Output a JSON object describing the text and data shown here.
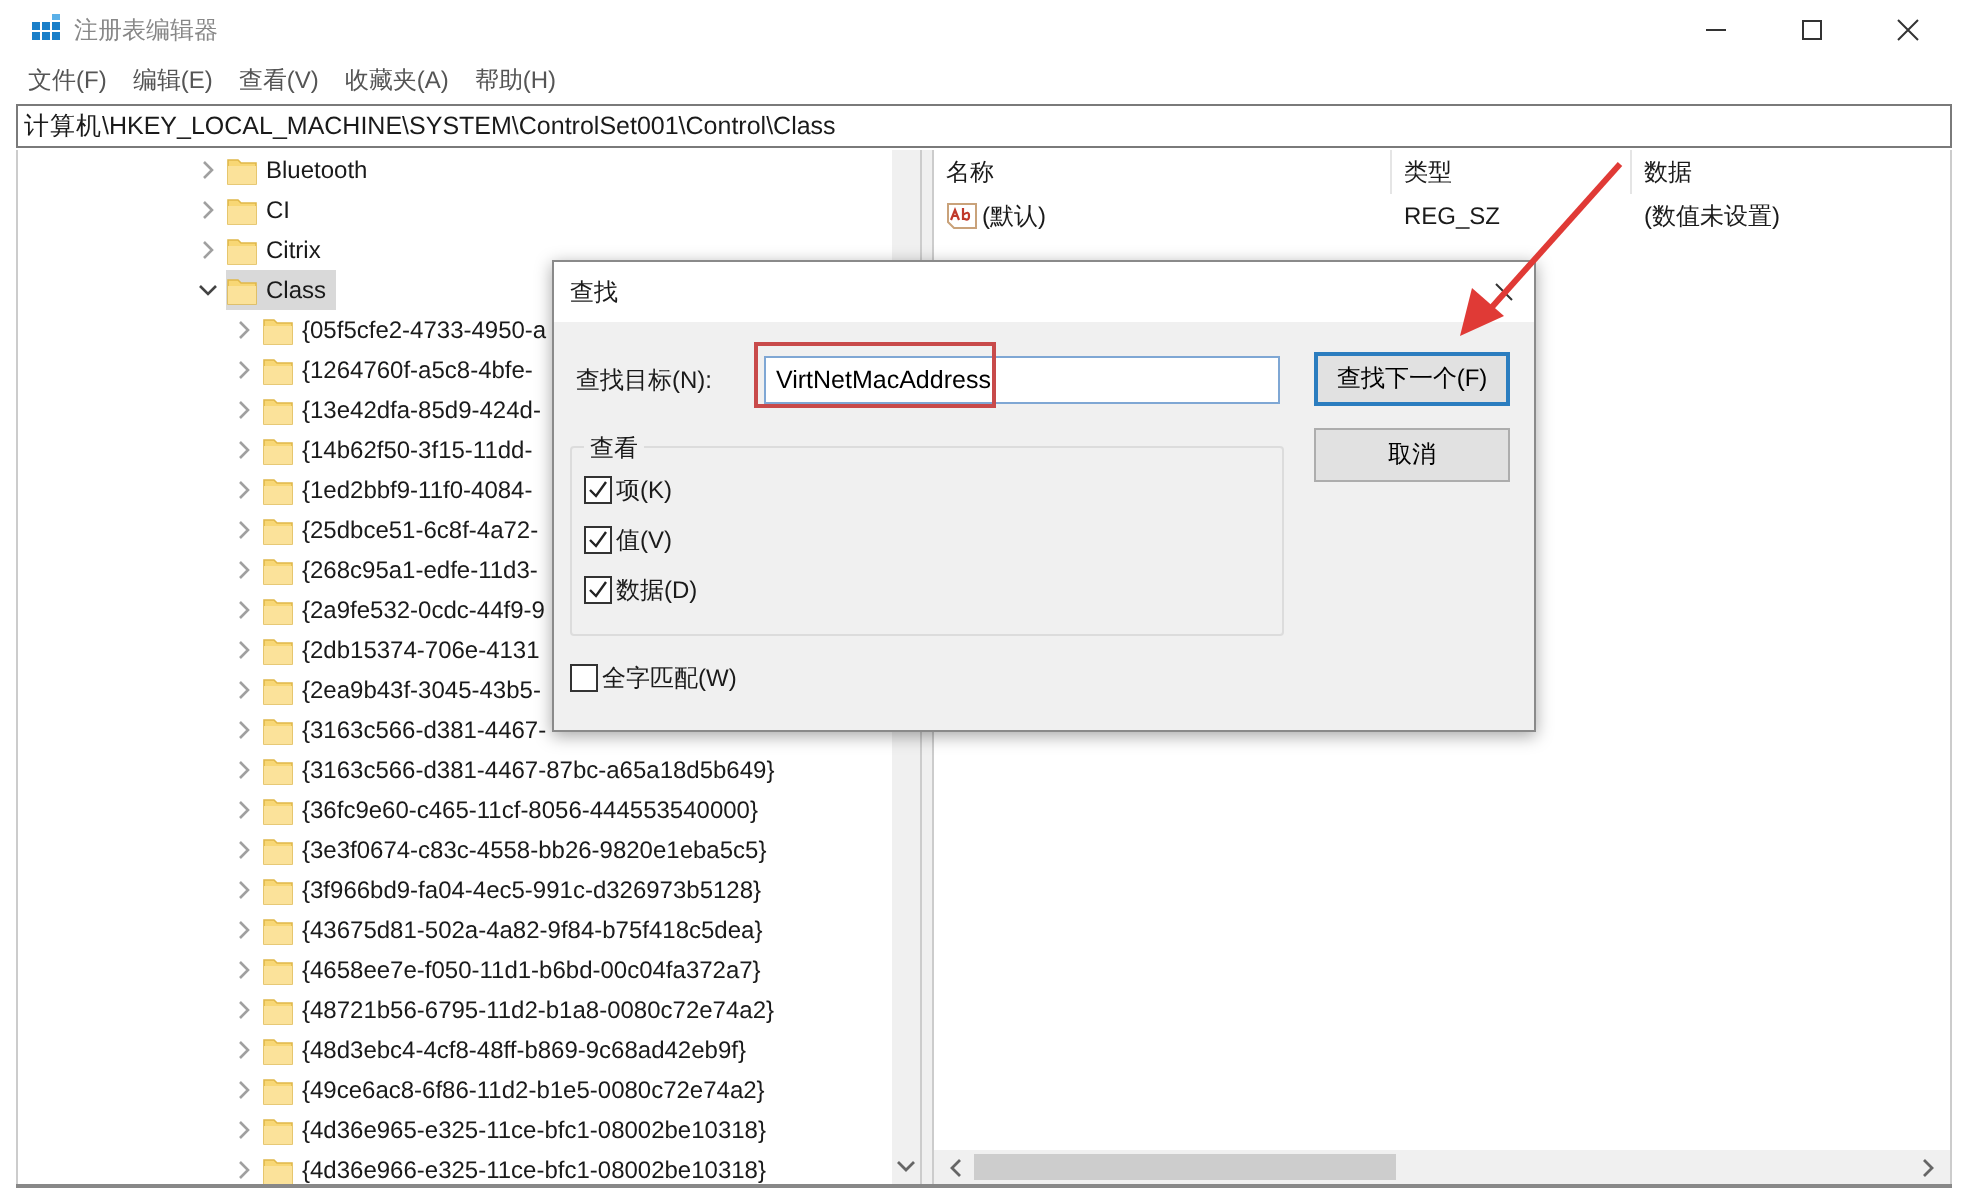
{
  "window": {
    "title": "注册表编辑器"
  },
  "menu": [
    "文件(F)",
    "编辑(E)",
    "查看(V)",
    "收藏夹(A)",
    "帮助(H)"
  ],
  "address": "计算机\\HKEY_LOCAL_MACHINE\\SYSTEM\\ControlSet001\\Control\\Class",
  "tree": [
    {
      "label": "Bluetooth",
      "expanded": false,
      "selected": false
    },
    {
      "label": "CI",
      "expanded": false,
      "selected": false
    },
    {
      "label": "Citrix",
      "expanded": false,
      "selected": false
    },
    {
      "label": "Class",
      "expanded": true,
      "selected": true,
      "children": [
        {
          "label": "{05f5cfe2-4733-4950-a",
          "expanded": false,
          "selected": false
        },
        {
          "label": "{1264760f-a5c8-4bfe-",
          "expanded": false,
          "selected": false
        },
        {
          "label": "{13e42dfa-85d9-424d-",
          "expanded": false,
          "selected": false
        },
        {
          "label": "{14b62f50-3f15-11dd-",
          "expanded": false,
          "selected": false
        },
        {
          "label": "{1ed2bbf9-11f0-4084-",
          "expanded": false,
          "selected": false
        },
        {
          "label": "{25dbce51-6c8f-4a72-",
          "expanded": false,
          "selected": false
        },
        {
          "label": "{268c95a1-edfe-11d3-",
          "expanded": false,
          "selected": false
        },
        {
          "label": "{2a9fe532-0cdc-44f9-9",
          "expanded": false,
          "selected": false
        },
        {
          "label": "{2db15374-706e-4131",
          "expanded": false,
          "selected": false
        },
        {
          "label": "{2ea9b43f-3045-43b5-",
          "expanded": false,
          "selected": false
        },
        {
          "label": "{3163c566-d381-4467-",
          "expanded": false,
          "selected": false
        },
        {
          "label": "{3163c566-d381-4467-87bc-a65a18d5b649}",
          "expanded": false,
          "selected": false
        },
        {
          "label": "{36fc9e60-c465-11cf-8056-444553540000}",
          "expanded": false,
          "selected": false
        },
        {
          "label": "{3e3f0674-c83c-4558-bb26-9820e1eba5c5}",
          "expanded": false,
          "selected": false
        },
        {
          "label": "{3f966bd9-fa04-4ec5-991c-d326973b5128}",
          "expanded": false,
          "selected": false
        },
        {
          "label": "{43675d81-502a-4a82-9f84-b75f418c5dea}",
          "expanded": false,
          "selected": false
        },
        {
          "label": "{4658ee7e-f050-11d1-b6bd-00c04fa372a7}",
          "expanded": false,
          "selected": false
        },
        {
          "label": "{48721b56-6795-11d2-b1a8-0080c72e74a2}",
          "expanded": false,
          "selected": false
        },
        {
          "label": "{48d3ebc4-4cf8-48ff-b869-9c68ad42eb9f}",
          "expanded": false,
          "selected": false
        },
        {
          "label": "{49ce6ac8-6f86-11d2-b1e5-0080c72e74a2}",
          "expanded": false,
          "selected": false
        },
        {
          "label": "{4d36e965-e325-11ce-bfc1-08002be10318}",
          "expanded": false,
          "selected": false
        },
        {
          "label": "{4d36e966-e325-11ce-bfc1-08002be10318}",
          "expanded": false,
          "selected": false
        }
      ]
    }
  ],
  "values": {
    "columns": [
      "名称",
      "类型",
      "数据"
    ],
    "rows": [
      {
        "name": "(默认)",
        "type": "REG_SZ",
        "data": "(数值未设置)"
      }
    ]
  },
  "find_dialog": {
    "title": "查找",
    "target_label": "查找目标(N):",
    "value": "VirtNetMacAddress",
    "group_label": "查看",
    "options": [
      {
        "label": "项(K)",
        "checked": true
      },
      {
        "label": "值(V)",
        "checked": true
      },
      {
        "label": "数据(D)",
        "checked": true
      }
    ],
    "whole_word": {
      "label": "全字匹配(W)",
      "checked": false
    },
    "buttons": [
      {
        "label": "查找下一个(F)",
        "kind": "default"
      },
      {
        "label": "取消",
        "kind": "normal"
      }
    ]
  }
}
